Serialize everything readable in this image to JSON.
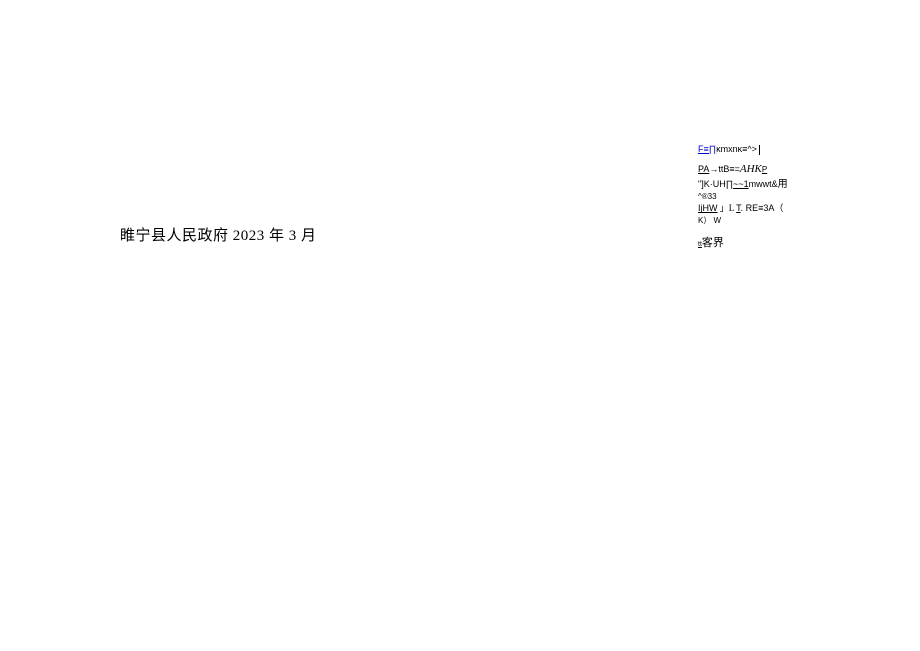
{
  "main": {
    "text": "睢宁县人民政府 2023 年 3 月"
  },
  "side": {
    "line1_underline": "F≡∏",
    "line1_rest": "ĸmxnĸ≡^>",
    "line2_pa": "PA",
    "line2_mid": "→ttB≡=",
    "line2_ahk": "AHK",
    "line2_p": "P",
    "line3_a": "\"]K·UH",
    "line3_under": "∏~~1",
    "line3_b": "mwwt&",
    "line3_cjk": "用",
    "line4": "^®33",
    "line5_ij": "IjHW",
    "line5_mid": " 」L ",
    "line5_t": "T",
    "line5_rest": ". RE≡3A（",
    "line6": "K） W",
    "line7_tt": "tt",
    "line7_cjk": "客界"
  }
}
